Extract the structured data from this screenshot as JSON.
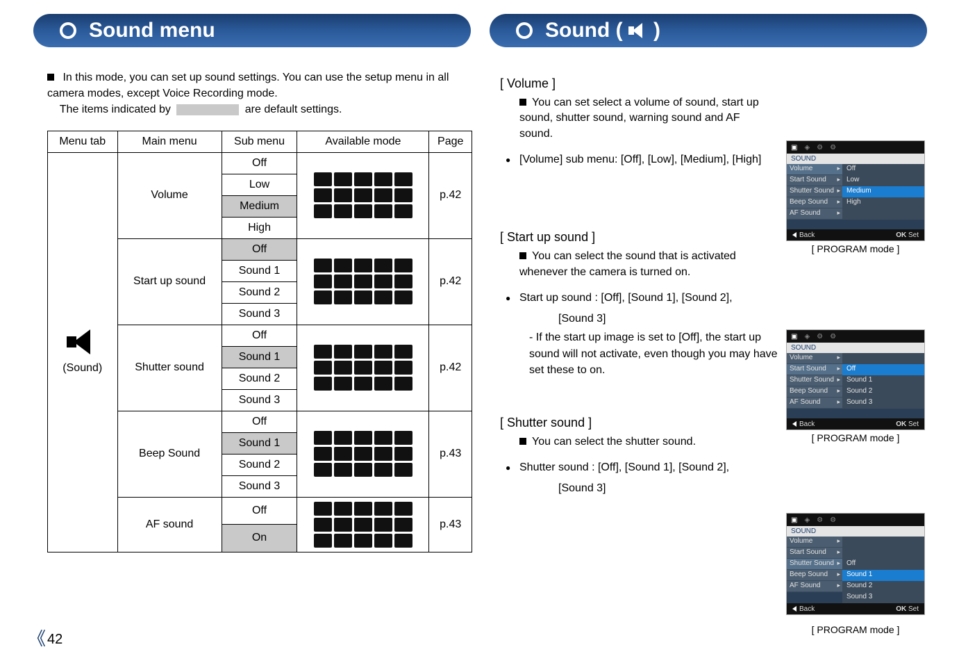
{
  "titles": {
    "left": "Sound menu",
    "right": "Sound ( "
  },
  "intro": {
    "line1": "In this mode, you can set up sound settings. You can use the setup menu in all camera modes, except Voice Recording mode.",
    "line2a": "The items indicated by",
    "line2b": "are default settings."
  },
  "table": {
    "headers": {
      "menu_tab": "Menu tab",
      "main_menu": "Main menu",
      "sub_menu": "Sub menu",
      "available_mode": "Available mode",
      "page": "Page"
    },
    "sound_label": "(Sound)",
    "groups": [
      {
        "main": "Volume",
        "subs": [
          "Off",
          "Low",
          "Medium",
          "High"
        ],
        "shaded_index": 2,
        "page": "p.42"
      },
      {
        "main": "Start up sound",
        "subs": [
          "Off",
          "Sound 1",
          "Sound 2",
          "Sound 3"
        ],
        "shaded_index": 0,
        "page": "p.42"
      },
      {
        "main": "Shutter sound",
        "subs": [
          "Off",
          "Sound 1",
          "Sound 2",
          "Sound 3"
        ],
        "shaded_index": 1,
        "page": "p.42"
      },
      {
        "main": "Beep Sound",
        "subs": [
          "Off",
          "Sound 1",
          "Sound 2",
          "Sound 3"
        ],
        "shaded_index": 1,
        "page": "p.43"
      },
      {
        "main": "AF sound",
        "subs": [
          "Off",
          "On"
        ],
        "shaded_index": 1,
        "page": "p.43"
      }
    ]
  },
  "volume": {
    "head": "[ Volume ]",
    "desc": "You can set select a volume of sound, start up sound, shutter sound, warning sound and AF sound.",
    "submenu": "[Volume] sub menu: [Off], [Low], [Medium], [High]"
  },
  "startup": {
    "head": "[ Start up sound ]",
    "desc": "You can select the sound that is activated whenever the camera is turned on.",
    "line1": "Start up sound : [Off], [Sound 1], [Sound 2],",
    "line1b": "[Sound 3]",
    "note": "- If the start up image is set to [Off], the start up sound will not activate, even though you may have set these to on."
  },
  "shutter": {
    "head": "[ Shutter sound ]",
    "desc": "You can select the shutter sound.",
    "line1": "Shutter sound : [Off], [Sound 1], [Sound 2],",
    "line1b": "[Sound 3]"
  },
  "lcd_common": {
    "sound_tab": "SOUND",
    "back": "Back",
    "ok": "OK",
    "set": "Set",
    "caption": "[ PROGRAM mode ]"
  },
  "lcd1": {
    "rows": [
      {
        "l": "Volume",
        "r": "Off",
        "h": false
      },
      {
        "l": "Start Sound",
        "r": "Low",
        "h": false
      },
      {
        "l": "Shutter Sound",
        "r": "Medium",
        "h": true
      },
      {
        "l": "Beep Sound",
        "r": "High",
        "h": false
      },
      {
        "l": "AF Sound",
        "r": "",
        "h": false
      }
    ],
    "active": 0
  },
  "lcd2": {
    "rows": [
      {
        "l": "Volume",
        "r": "",
        "h": false
      },
      {
        "l": "Start Sound",
        "r": "Off",
        "h": true
      },
      {
        "l": "Shutter Sound",
        "r": "Sound 1",
        "h": false
      },
      {
        "l": "Beep Sound",
        "r": "Sound 2",
        "h": false
      },
      {
        "l": "AF Sound",
        "r": "Sound 3",
        "h": false
      }
    ],
    "active": 1
  },
  "lcd3": {
    "rows": [
      {
        "l": "Volume",
        "r": "",
        "h": false
      },
      {
        "l": "Start Sound",
        "r": "",
        "h": false
      },
      {
        "l": "Shutter Sound",
        "r": "Off",
        "h": false
      },
      {
        "l": "Beep Sound",
        "r": "Sound 1",
        "h": true
      },
      {
        "l": "AF Sound",
        "r": "Sound 2",
        "h": false
      },
      {
        "l": "",
        "r": "Sound 3",
        "h": false
      }
    ],
    "active": 2
  },
  "page_number": "42"
}
